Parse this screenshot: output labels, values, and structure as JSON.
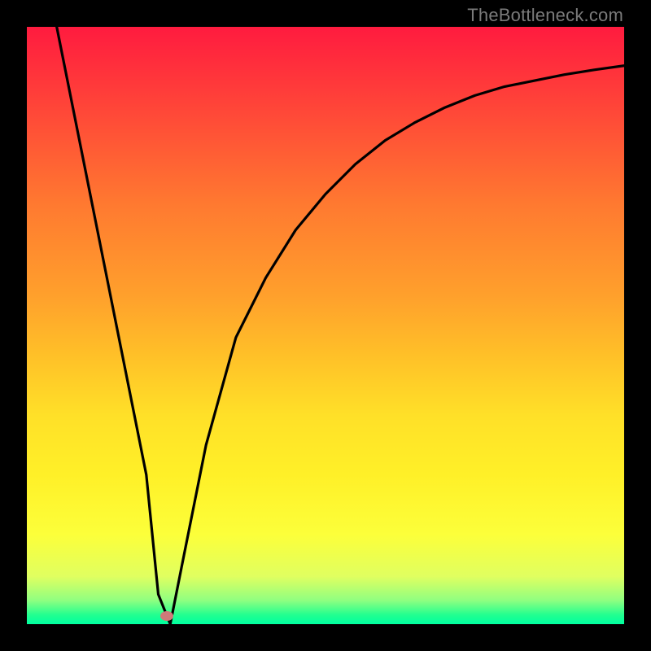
{
  "watermark": "TheBottleneck.com",
  "chart_data": {
    "type": "line",
    "title": "",
    "xlabel": "",
    "ylabel": "",
    "xlim": [
      0,
      100
    ],
    "ylim": [
      0,
      100
    ],
    "grid": false,
    "series": [
      {
        "name": "bottleneck-curve",
        "x": [
          5,
          10,
          15,
          20,
          22,
          24,
          26,
          30,
          35,
          40,
          45,
          50,
          55,
          60,
          65,
          70,
          75,
          80,
          85,
          90,
          95,
          100
        ],
        "values": [
          100,
          75,
          50,
          25,
          5,
          0,
          10,
          30,
          48,
          58,
          66,
          72,
          77,
          81,
          84,
          86.5,
          88.5,
          90,
          91,
          92,
          92.8,
          93.5
        ]
      }
    ],
    "marker": {
      "x": 23.5,
      "y": 1.4
    },
    "colors": {
      "curve": "#000000",
      "marker": "#cf7a79",
      "gradient_top": "#ff1b3f",
      "gradient_bottom": "#00ffa0",
      "frame": "#000000"
    }
  }
}
